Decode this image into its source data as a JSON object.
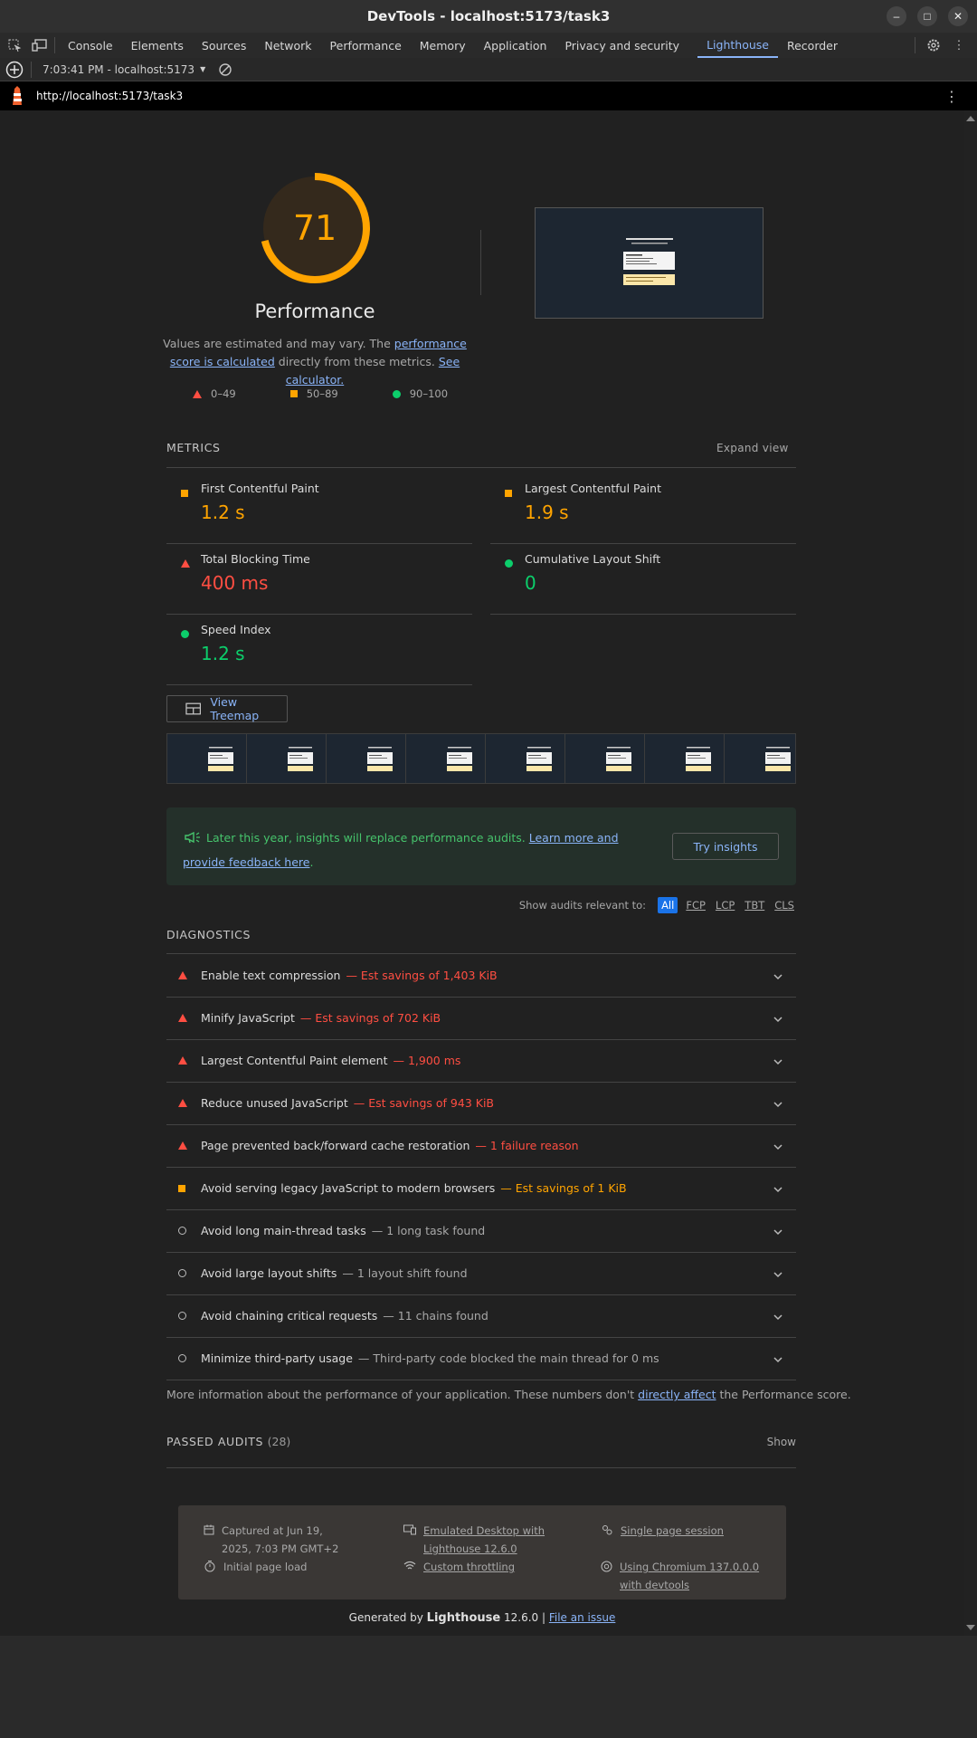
{
  "window": {
    "title": "DevTools - localhost:5173/task3"
  },
  "tabs": [
    "Console",
    "Elements",
    "Sources",
    "Network",
    "Performance",
    "Memory",
    "Application",
    "Privacy and security",
    "Lighthouse",
    "Recorder"
  ],
  "active_tab": "Lighthouse",
  "toolbar": {
    "report_selector": "7:03:41 PM - localhost:5173"
  },
  "url": "http://localhost:5173/task3",
  "score": {
    "value": "71",
    "fraction": 0.71,
    "label": "Performance"
  },
  "description": {
    "prefix": "Values are estimated and may vary. The ",
    "link1": "performance score is calculated",
    "mid": " directly from these metrics. ",
    "link2": "See calculator."
  },
  "legend": [
    {
      "label": "0–49",
      "shape": "triangle",
      "color": "#ff4e42"
    },
    {
      "label": "50–89",
      "shape": "square",
      "color": "#ffa400"
    },
    {
      "label": "90–100",
      "shape": "circle",
      "color": "#0cce6b"
    }
  ],
  "metrics_section": {
    "title": "METRICS",
    "expand": "Expand view"
  },
  "metrics": [
    {
      "label": "First Contentful Paint",
      "value": "1.2 s",
      "rating": "average",
      "color": "#ffa400"
    },
    {
      "label": "Largest Contentful Paint",
      "value": "1.9 s",
      "rating": "average",
      "color": "#ffa400"
    },
    {
      "label": "Total Blocking Time",
      "value": "400 ms",
      "rating": "fail",
      "color": "#ff4e42"
    },
    {
      "label": "Cumulative Layout Shift",
      "value": "0",
      "rating": "pass",
      "color": "#0cce6b"
    },
    {
      "label": "Speed Index",
      "value": "1.2 s",
      "rating": "pass",
      "color": "#0cce6b"
    }
  ],
  "treemap_button": "View Treemap",
  "insights": {
    "text": "Later this year, insights will replace performance audits. ",
    "link": "Learn more and provide feedback here",
    "button": "Try insights"
  },
  "filters": {
    "label": "Show audits relevant to:",
    "options": [
      "All",
      "FCP",
      "LCP",
      "TBT",
      "CLS"
    ],
    "selected": "All"
  },
  "diagnostics_title": "DIAGNOSTICS",
  "audits": [
    {
      "title": "Enable text compression",
      "detail": "— Est savings of 1,403 KiB",
      "rating": "fail",
      "color": "#ff4e42"
    },
    {
      "title": "Minify JavaScript",
      "detail": "— Est savings of 702 KiB",
      "rating": "fail",
      "color": "#ff4e42"
    },
    {
      "title": "Largest Contentful Paint element",
      "detail": "— 1,900 ms",
      "rating": "fail",
      "color": "#ff4e42"
    },
    {
      "title": "Reduce unused JavaScript",
      "detail": "— Est savings of 943 KiB",
      "rating": "fail",
      "color": "#ff4e42"
    },
    {
      "title": "Page prevented back/forward cache restoration",
      "detail": "— 1 failure reason",
      "rating": "fail",
      "color": "#ff4e42"
    },
    {
      "title": "Avoid serving legacy JavaScript to modern browsers",
      "detail": "— Est savings of 1 KiB",
      "rating": "average",
      "color": "#ffa400"
    },
    {
      "title": "Avoid long main-thread tasks",
      "detail": "— 1 long task found",
      "rating": "info",
      "color": "#a8a8a8"
    },
    {
      "title": "Avoid large layout shifts",
      "detail": "— 1 layout shift found",
      "rating": "info",
      "color": "#a8a8a8"
    },
    {
      "title": "Avoid chaining critical requests",
      "detail": "— 11 chains found",
      "rating": "info",
      "color": "#a8a8a8"
    },
    {
      "title": "Minimize third-party usage",
      "detail": "— Third-party code blocked the main thread for 0 ms",
      "rating": "info",
      "color": "#a8a8a8"
    }
  ],
  "more_info": {
    "prefix": "More information about the performance of your application. These numbers don't ",
    "link": "directly affect",
    "suffix": " the Performance score."
  },
  "passed": {
    "title": "PASSED AUDITS",
    "count": "(28)",
    "toggle": "Show"
  },
  "env": {
    "captured": "Captured at Jun 19, 2025, 7:03 PM GMT+2",
    "initial": "Initial page load",
    "emulated": "Emulated Desktop with Lighthouse 12.6.0",
    "throttling": "Custom throttling",
    "session": "Single page session",
    "chromium": "Using Chromium 137.0.0.0 with devtools"
  },
  "generated": {
    "prefix": "Generated by ",
    "brand": "Lighthouse",
    "version": " 12.6.0 | ",
    "link": "File an issue"
  },
  "colors": {
    "accent": "#8ab4f8",
    "fail": "#ff4e42",
    "average": "#ffa400",
    "pass": "#0cce6b"
  }
}
